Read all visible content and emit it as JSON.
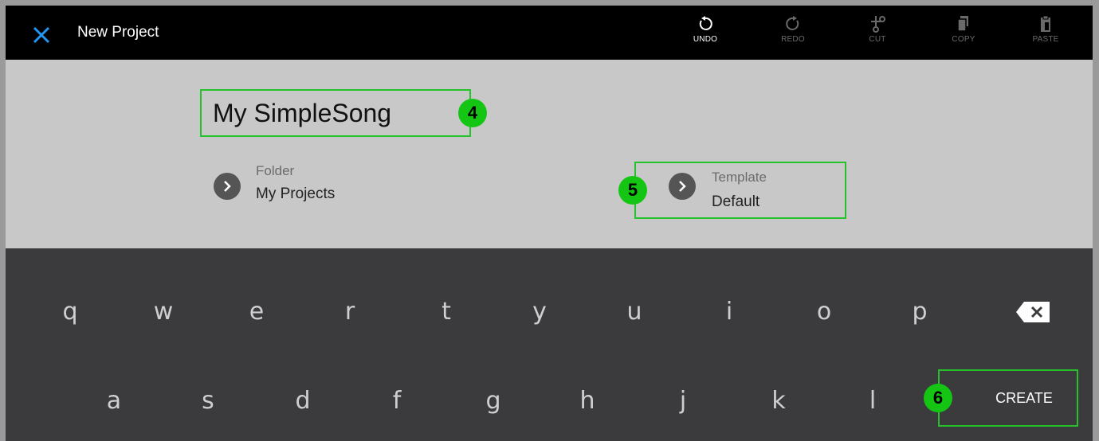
{
  "topbar": {
    "title": "New Project",
    "tools": [
      {
        "label": "UNDO",
        "icon": "undo-icon",
        "enabled": true
      },
      {
        "label": "REDO",
        "icon": "redo-icon",
        "enabled": false
      },
      {
        "label": "CUT",
        "icon": "scissors-icon",
        "enabled": false
      },
      {
        "label": "COPY",
        "icon": "copy-icon",
        "enabled": false
      },
      {
        "label": "PASTE",
        "icon": "paste-icon",
        "enabled": false
      }
    ]
  },
  "project": {
    "name": "My SimpleSong",
    "folder_label": "Folder",
    "folder_value": "My Projects",
    "template_label": "Template",
    "template_value": "Default"
  },
  "markers": [
    "4",
    "5",
    "6"
  ],
  "keyboard": {
    "row1": [
      "q",
      "w",
      "e",
      "r",
      "t",
      "y",
      "u",
      "i",
      "o",
      "p"
    ],
    "row2": [
      "a",
      "s",
      "d",
      "f",
      "g",
      "h",
      "j",
      "k",
      "l"
    ],
    "create_label": "CREATE"
  },
  "colors": {
    "accent_blue": "#2196f3",
    "highlight_green": "#25c22c",
    "marker_green": "#14c514",
    "keyboard_bg": "#3b3b3e",
    "settings_bg": "#c8c8c8"
  }
}
